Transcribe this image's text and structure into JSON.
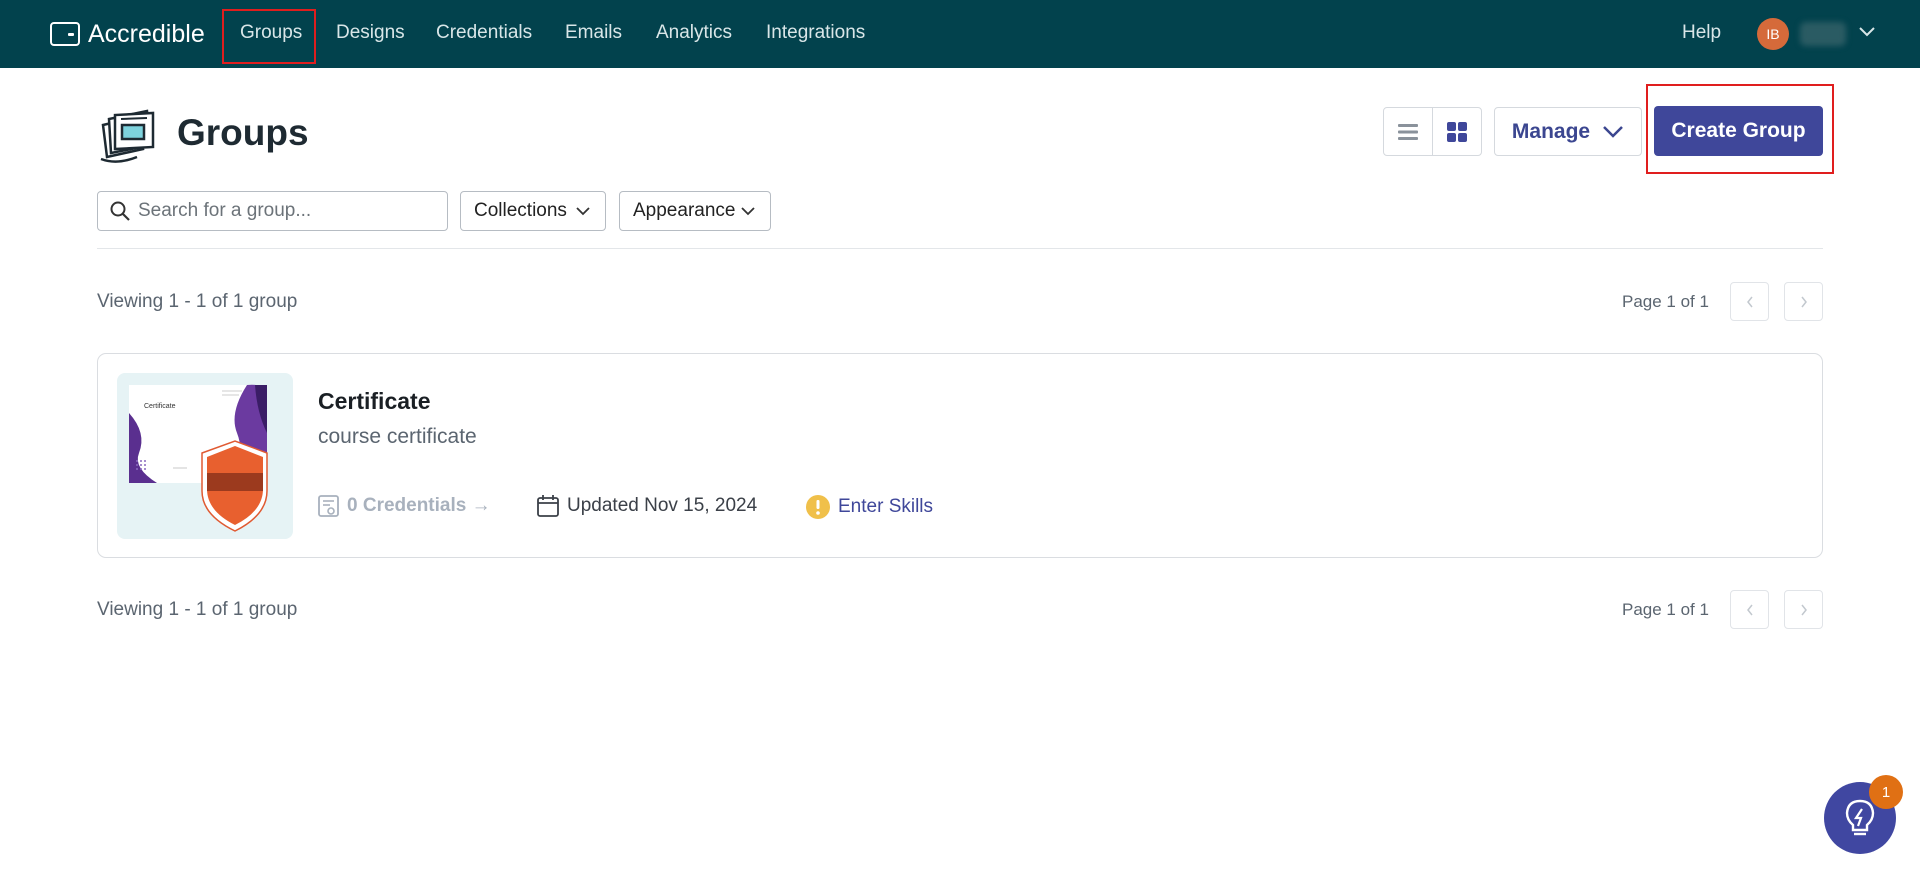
{
  "app": {
    "name": "Accredible"
  },
  "nav": {
    "items": [
      {
        "label": "Groups"
      },
      {
        "label": "Designs"
      },
      {
        "label": "Credentials"
      },
      {
        "label": "Emails"
      },
      {
        "label": "Analytics"
      },
      {
        "label": "Integrations"
      }
    ],
    "help": "Help",
    "user_initials": "IB"
  },
  "header": {
    "title": "Groups",
    "manage_label": "Manage",
    "create_label": "Create Group"
  },
  "filters": {
    "search_placeholder": "Search for a group...",
    "collections_label": "Collections",
    "appearance_label": "Appearance"
  },
  "pagination": {
    "viewing_text": "Viewing 1 - 1 of 1 group",
    "page_text": "Page 1 of 1"
  },
  "groups": [
    {
      "name": "Certificate",
      "description": "course certificate",
      "thumbnail_text": "Certificate",
      "credentials": "0 Credentials →",
      "updated": "Updated Nov 15, 2024",
      "skills": "Enter Skills"
    }
  ],
  "help_badge_count": "1",
  "colors": {
    "topbar": "#02424d",
    "primary": "#3f479a",
    "badge": "#e07014",
    "highlight": "#e01e1e"
  }
}
